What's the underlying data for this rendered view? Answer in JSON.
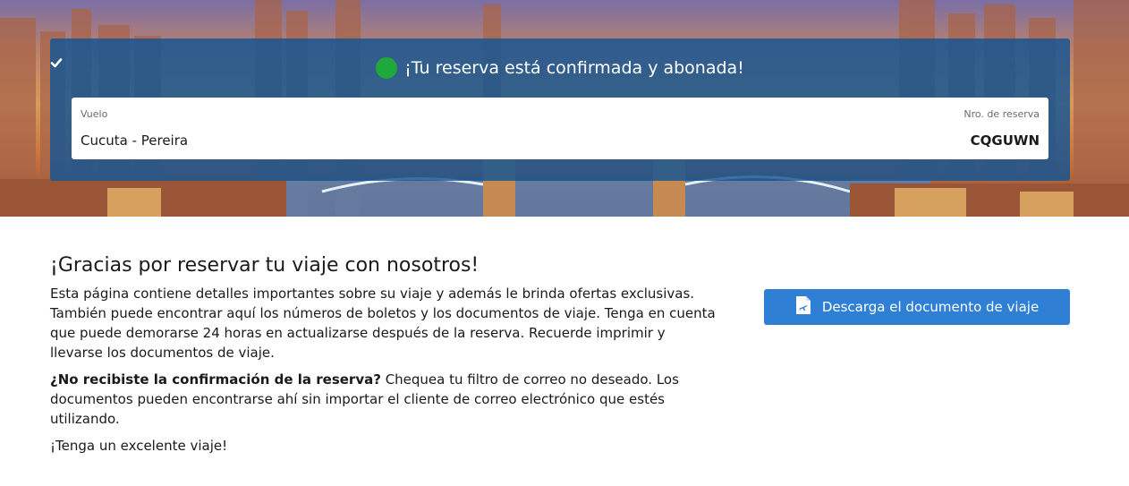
{
  "banner": {
    "confirmation_text": "¡Tu reserva está confirmada y abonada!",
    "flight_label": "Vuelo",
    "flight_value": "Cucuta - Pereira",
    "booking_label": "Nro. de reserva",
    "booking_value": "CQGUWN"
  },
  "main": {
    "heading": "¡Gracias por reservar tu viaje con nosotros!",
    "paragraph1": "Esta página contiene detalles importantes sobre su viaje y además le brinda ofertas exclusivas. También puede encontrar aquí los números de boletos y los documentos de viaje. Tenga en cuenta que puede demorarse 24 horas en actualizarse después de la reserva. Recuerde imprimir y llevarse los documentos de viaje.",
    "question_bold": "¿No recibiste la confirmación de la reserva?",
    "question_rest": " Chequea tu filtro de correo no deseado. Los documentos pueden encontrarse ahí sin importar el cliente de correo electrónico que estés utilizando.",
    "closing": "¡Tenga un excelente viaje!"
  },
  "download": {
    "label": "Descarga el documento de viaje",
    "icon": "ticket-document-icon"
  },
  "icons": {
    "confirmation": "check-circle-icon"
  },
  "colors": {
    "panel": "#125494",
    "check": "#1fa83c",
    "button": "#2f80d5"
  }
}
